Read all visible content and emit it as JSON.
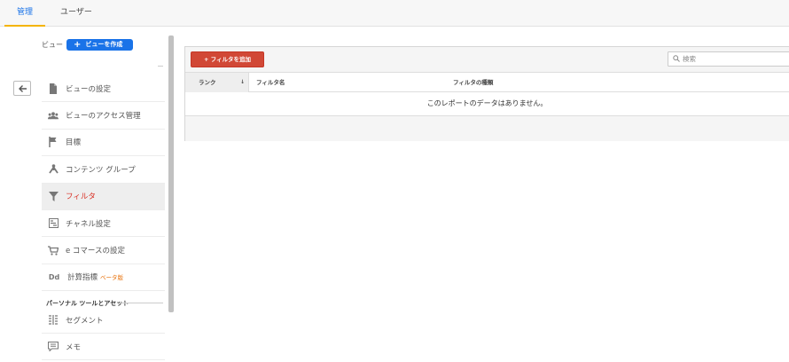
{
  "tabs": [
    {
      "label": "管理",
      "active": true
    },
    {
      "label": "ユーザー",
      "active": false
    }
  ],
  "view_section": {
    "label": "ビュー",
    "create_button": "ビューを作成"
  },
  "nav_items": [
    {
      "label": "ビューの設定",
      "icon": "document-icon"
    },
    {
      "label": "ビューのアクセス管理",
      "icon": "people-icon"
    },
    {
      "label": "目標",
      "icon": "flag-icon"
    },
    {
      "label": "コンテンツ グループ",
      "icon": "content-group-icon"
    },
    {
      "label": "フィルタ",
      "icon": "filter-icon",
      "active": true
    },
    {
      "label": "チャネル設定",
      "icon": "channel-icon"
    },
    {
      "label": "e コマースの設定",
      "icon": "cart-icon"
    },
    {
      "label": "計算指標",
      "icon": "dd-icon",
      "badge": "ベータ版"
    }
  ],
  "personal_section": {
    "title": "パーソナル ツールとアセット",
    "items": [
      {
        "label": "セグメント",
        "icon": "segment-icon"
      },
      {
        "label": "メモ",
        "icon": "memo-icon"
      }
    ]
  },
  "toolbar": {
    "add_filter_label": "+ フィルタを追加",
    "search_placeholder": "検索"
  },
  "table": {
    "columns": [
      "ランク",
      "フィルタ名",
      "フィルタの種類"
    ],
    "empty_message": "このレポートのデータはありません。"
  },
  "colors": {
    "accent_blue": "#1a73e8",
    "active_tab_underline": "#f4b400",
    "add_button": "#d14836",
    "active_nav_text": "#d93025",
    "beta_badge": "#e8710a"
  }
}
